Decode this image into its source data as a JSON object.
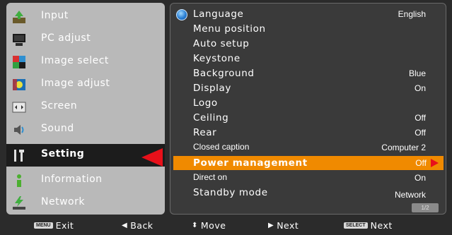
{
  "left_menu": [
    {
      "label": "Input",
      "icon": "input-icon"
    },
    {
      "label": "PC adjust",
      "icon": "pc-adjust-icon"
    },
    {
      "label": "Image select",
      "icon": "image-select-icon"
    },
    {
      "label": "Image adjust",
      "icon": "image-adjust-icon"
    },
    {
      "label": "Screen",
      "icon": "screen-icon"
    },
    {
      "label": "Sound",
      "icon": "sound-icon"
    },
    {
      "label": "Setting",
      "icon": "setting-icon"
    },
    {
      "label": "Information",
      "icon": "information-icon"
    },
    {
      "label": "Network",
      "icon": "network-icon"
    }
  ],
  "selected_left_item": "Setting",
  "settings": [
    {
      "label": "Language",
      "value": "English"
    },
    {
      "label": "Menu position",
      "value": ""
    },
    {
      "label": "Auto setup",
      "value": ""
    },
    {
      "label": "Keystone",
      "value": ""
    },
    {
      "label": "Background",
      "value": "Blue"
    },
    {
      "label": "Display",
      "value": "On"
    },
    {
      "label": "Logo",
      "value": ""
    },
    {
      "label": "Ceiling",
      "value": "Off"
    },
    {
      "label": "Rear",
      "value": "Off"
    },
    {
      "label": "Closed caption",
      "value": "Computer 2"
    },
    {
      "label": "Power management",
      "value": "Off"
    },
    {
      "label": "Direct on",
      "value": "On"
    },
    {
      "label": "Standby mode",
      "value": "Network"
    }
  ],
  "highlighted_setting": "Power management",
  "page_indicator": "1/2",
  "bottom_bar": {
    "exit_key": "MENU",
    "exit": "Exit",
    "back": "Back",
    "move": "Move",
    "next": "Next",
    "select_key": "SELECT",
    "select_next": "Next"
  },
  "colors": {
    "highlight": "#f08a00",
    "pointer": "#e8101a",
    "left_panel": "#b9b9b9",
    "right_panel": "#3a3a3a"
  }
}
